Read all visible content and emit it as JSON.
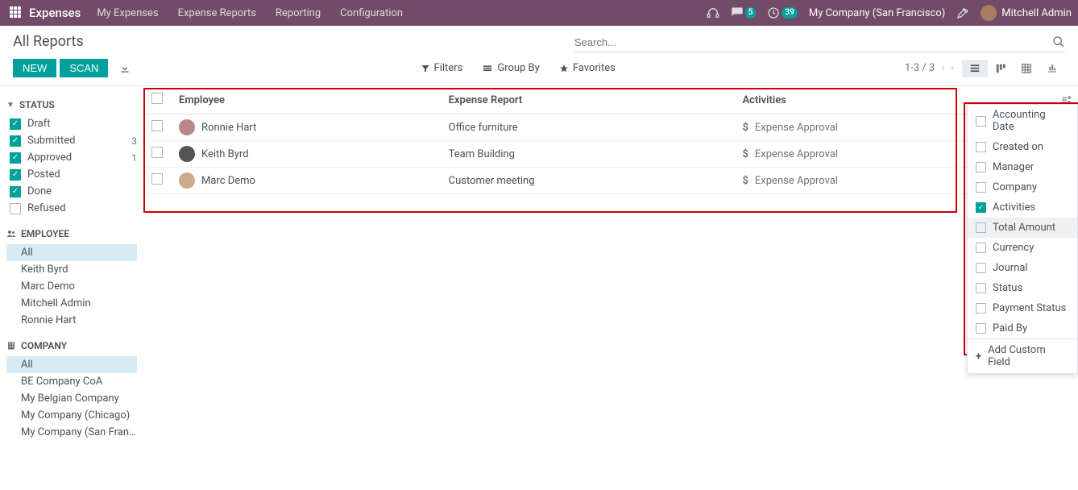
{
  "navbar": {
    "brand": "Expenses",
    "links": [
      "My Expenses",
      "Expense Reports",
      "Reporting",
      "Configuration"
    ],
    "msg_count": "5",
    "clock_count": "39",
    "company": "My Company (San Francisco)",
    "user": "Mitchell Admin"
  },
  "breadcrumb": {
    "title": "All Reports"
  },
  "search": {
    "placeholder": "Search..."
  },
  "buttons": {
    "new": "NEW",
    "scan": "SCAN"
  },
  "toolbar": {
    "filters": "Filters",
    "groupby": "Group By",
    "favorites": "Favorites"
  },
  "pager": {
    "range": "1-3 / 3"
  },
  "facets": {
    "status_title": "STATUS",
    "status": [
      {
        "label": "Draft",
        "checked": true,
        "count": ""
      },
      {
        "label": "Submitted",
        "checked": true,
        "count": "3"
      },
      {
        "label": "Approved",
        "checked": true,
        "count": "1"
      },
      {
        "label": "Posted",
        "checked": true,
        "count": ""
      },
      {
        "label": "Done",
        "checked": true,
        "count": ""
      },
      {
        "label": "Refused",
        "checked": false,
        "count": ""
      }
    ],
    "employee_title": "EMPLOYEE",
    "employee": [
      {
        "label": "All",
        "active": true
      },
      {
        "label": "Keith Byrd",
        "active": false
      },
      {
        "label": "Marc Demo",
        "active": false
      },
      {
        "label": "Mitchell Admin",
        "active": false
      },
      {
        "label": "Ronnie Hart",
        "active": false
      }
    ],
    "company_title": "COMPANY",
    "company": [
      {
        "label": "All",
        "active": true
      },
      {
        "label": "BE Company CoA",
        "active": false
      },
      {
        "label": "My Belgian Company",
        "active": false
      },
      {
        "label": "My Company (Chicago)",
        "active": false
      },
      {
        "label": "My Company (San Franc...",
        "active": false
      }
    ]
  },
  "table": {
    "headers": {
      "employee": "Employee",
      "report": "Expense Report",
      "activities": "Activities"
    },
    "rows": [
      {
        "employee": "Ronnie Hart",
        "report": "Office furniture",
        "activity": "Expense Approval"
      },
      {
        "employee": "Keith Byrd",
        "report": "Team Building",
        "activity": "Expense Approval"
      },
      {
        "employee": "Marc Demo",
        "report": "Customer meeting",
        "activity": "Expense Approval"
      }
    ]
  },
  "fields_panel": {
    "items": [
      {
        "label": "Accounting Date",
        "checked": false
      },
      {
        "label": "Created on",
        "checked": false
      },
      {
        "label": "Manager",
        "checked": false
      },
      {
        "label": "Company",
        "checked": false
      },
      {
        "label": "Activities",
        "checked": true
      },
      {
        "label": "Total Amount",
        "checked": false,
        "hover": true
      },
      {
        "label": "Currency",
        "checked": false
      },
      {
        "label": "Journal",
        "checked": false
      },
      {
        "label": "Status",
        "checked": false
      },
      {
        "label": "Payment Status",
        "checked": false
      },
      {
        "label": "Paid By",
        "checked": false
      }
    ],
    "add_custom": "Add Custom Field"
  }
}
